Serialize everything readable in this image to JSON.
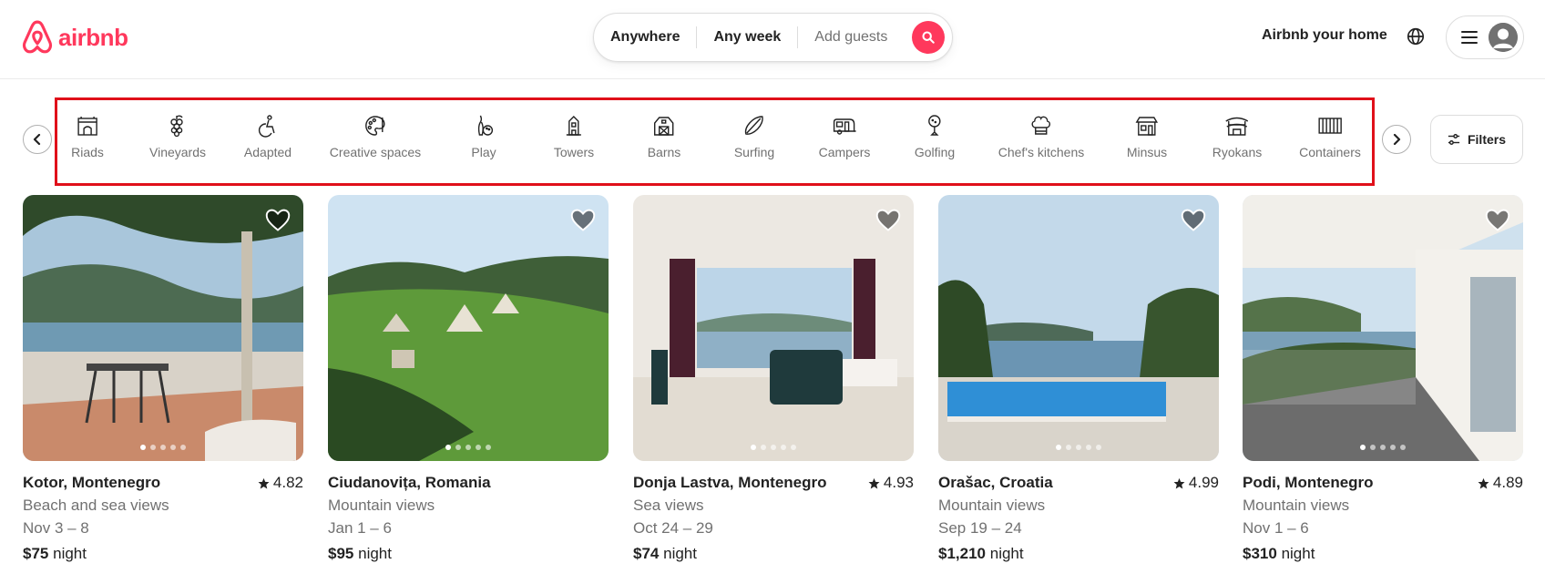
{
  "brand": {
    "name": "airbnb",
    "color": "#ff385c"
  },
  "search": {
    "where": "Anywhere",
    "when": "Any week",
    "guests_placeholder": "Add guests",
    "icon": "search-icon"
  },
  "header_right": {
    "host_link": "Airbnb your home",
    "globe_icon": "globe-icon",
    "menu_icon": "hamburger-icon",
    "avatar_icon": "user-avatar-icon"
  },
  "categories": [
    {
      "label": "Riads",
      "icon": "riad-icon"
    },
    {
      "label": "Vineyards",
      "icon": "grapes-icon"
    },
    {
      "label": "Adapted",
      "icon": "accessible-icon"
    },
    {
      "label": "Creative spaces",
      "icon": "palette-icon"
    },
    {
      "label": "Play",
      "icon": "bowling-icon"
    },
    {
      "label": "Towers",
      "icon": "tower-icon"
    },
    {
      "label": "Barns",
      "icon": "barn-icon"
    },
    {
      "label": "Surfing",
      "icon": "surfboard-icon"
    },
    {
      "label": "Campers",
      "icon": "camper-icon"
    },
    {
      "label": "Golfing",
      "icon": "golf-icon"
    },
    {
      "label": "Chef's kitchens",
      "icon": "chef-hat-icon"
    },
    {
      "label": "Minsus",
      "icon": "minsu-icon"
    },
    {
      "label": "Ryokans",
      "icon": "ryokan-icon"
    },
    {
      "label": "Containers",
      "icon": "container-icon"
    }
  ],
  "filters": {
    "label": "Filters",
    "icon": "sliders-icon"
  },
  "listings": [
    {
      "location": "Kotor, Montenegro",
      "rating": "4.82",
      "subtitle": "Beach and sea views",
      "dates": "Nov 3 – 8",
      "price": "$75",
      "unit": "night"
    },
    {
      "location": "Ciudanovița, Romania",
      "rating": "",
      "subtitle": "Mountain views",
      "dates": "Jan 1 – 6",
      "price": "$95",
      "unit": "night"
    },
    {
      "location": "Donja Lastva, Montenegro",
      "rating": "4.93",
      "subtitle": "Sea views",
      "dates": "Oct 24 – 29",
      "price": "$74",
      "unit": "night"
    },
    {
      "location": "Orašac, Croatia",
      "rating": "4.99",
      "subtitle": "Mountain views",
      "dates": "Sep 19 – 24",
      "price": "$1,210",
      "unit": "night"
    },
    {
      "location": "Podi, Montenegro",
      "rating": "4.89",
      "subtitle": "Mountain views",
      "dates": "Nov 1 – 6",
      "price": "$310",
      "unit": "night"
    }
  ]
}
